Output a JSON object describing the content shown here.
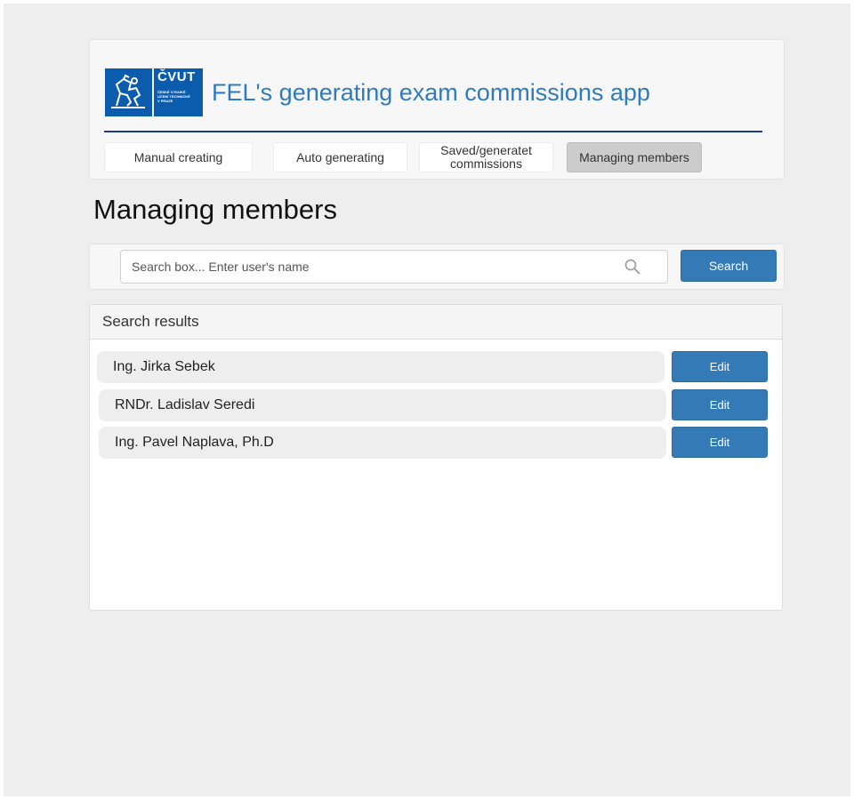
{
  "header": {
    "logo": {
      "title": "ČVUT",
      "subtitle_lines": [
        "ČESKÉ VYSOKÉ",
        "UČENÍ TECHNICKÉ",
        "V PRAZE"
      ]
    },
    "app_title": "FEL's generating exam commissions app",
    "rule_color": "#1e3a8a"
  },
  "nav": {
    "tabs": [
      {
        "label": "Manual creating",
        "active": false
      },
      {
        "label": "Auto generating",
        "active": false
      },
      {
        "label": "Saved/generatet commissions",
        "active": false
      },
      {
        "label": "Managing members",
        "active": true
      }
    ]
  },
  "page_title": "Managing members",
  "search": {
    "placeholder": "Search box... Enter user's name",
    "value": "",
    "icon": "search-icon",
    "button_label": "Search"
  },
  "results": {
    "header": "Search results",
    "items": [
      {
        "name": "Ing. Jirka Sebek",
        "action_label": "Edit"
      },
      {
        "name": "RNDr. Ladislav Seredi",
        "action_label": "Edit"
      },
      {
        "name": "Ing. Pavel Naplava, Ph.D",
        "action_label": "Edit"
      }
    ]
  },
  "colors": {
    "accent": "#337ab7",
    "title_blue": "#2f7bbf",
    "logo_blue": "#0b5cad",
    "background": "#eeeeee"
  }
}
